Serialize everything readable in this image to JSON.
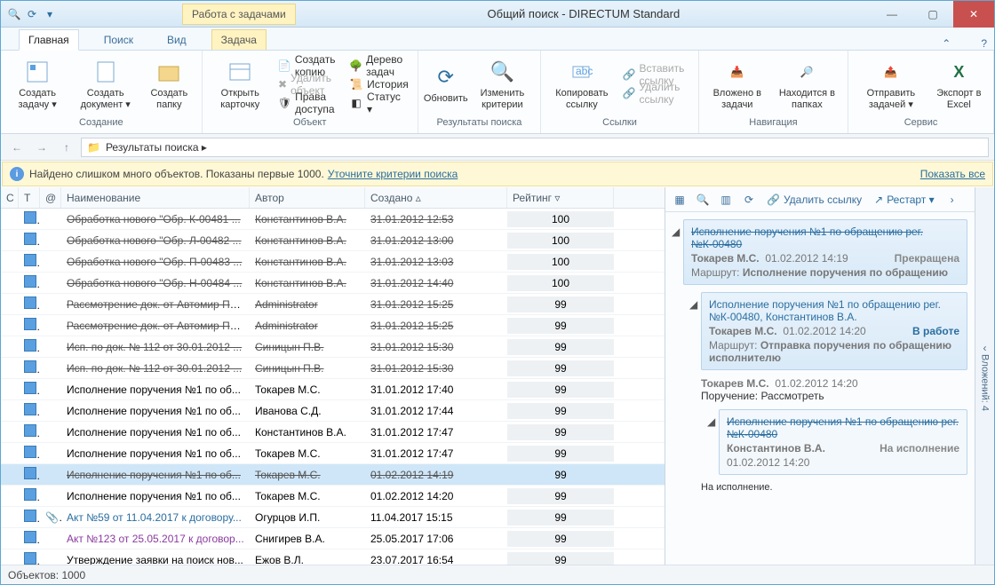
{
  "window": {
    "title": "Общий поиск - DIRECTUM Standard"
  },
  "ctx_header": "Работа с задачами",
  "tabs": {
    "main": "Главная",
    "search": "Поиск",
    "view": "Вид",
    "task": "Задача"
  },
  "ribbon": {
    "create_task": "Создать задачу ▾",
    "create_doc": "Создать документ ▾",
    "create_folder": "Создать папку",
    "open_card": "Открыть карточку",
    "copy": "Создать копию",
    "del": "Удалить объект",
    "rights": "Права доступа",
    "tree": "Дерево задач",
    "history": "История",
    "status": "Статус ▾",
    "refresh": "Обновить",
    "criteria": "Изменить критерии",
    "copylink": "Копировать ссылку",
    "pastelink": "Вставить ссылку",
    "dellink": "Удалить ссылку",
    "inv_tasks": "Вложено в задачи",
    "in_folders": "Находится в папках",
    "send_tasks": "Отправить задачей ▾",
    "excel": "Экспорт в Excel",
    "grp_create": "Создание",
    "grp_obj": "Объект",
    "grp_res": "Результаты поиска",
    "grp_links": "Ссылки",
    "grp_nav": "Навигация",
    "grp_srv": "Сервис"
  },
  "crumb": "Результаты поиска ▸",
  "info": {
    "text": "Найдено слишком много объектов. Показаны первые 1000.",
    "refine": "Уточните критерии поиска",
    "all": "Показать все"
  },
  "cols": {
    "c": "С",
    "t": "Т",
    "a": "@",
    "name": "Наименование",
    "author": "Автор",
    "created": "Создано",
    "rating": "Рейтинг"
  },
  "rows": [
    {
      "strike": true,
      "name": "Обработка нового \"Обр. К-00481 ...",
      "auth": "Константинов В.А.",
      "date": "31.01.2012 12:53",
      "rate": "100"
    },
    {
      "strike": true,
      "name": "Обработка нового \"Обр. Л-00482 ...",
      "auth": "Константинов В.А.",
      "date": "31.01.2012 13:00",
      "rate": "100"
    },
    {
      "strike": true,
      "name": "Обработка нового \"Обр. П-00483 ...",
      "auth": "Константинов В.А.",
      "date": "31.01.2012 13:03",
      "rate": "100"
    },
    {
      "strike": true,
      "name": "Обработка нового \"Обр. Н-00484 ...",
      "auth": "Константинов В.А.",
      "date": "31.01.2012 14:40",
      "rate": "100"
    },
    {
      "strike": true,
      "name": "Рассмотрение док. от Автомир Пи...",
      "auth": "Administrator",
      "date": "31.01.2012 15:25",
      "rate": "99"
    },
    {
      "strike": true,
      "name": "Рассмотрение док. от Автомир Пи...",
      "auth": "Administrator",
      "date": "31.01.2012 15:25",
      "rate": "99"
    },
    {
      "strike": true,
      "name": "Исп. по док. № 112 от 30.01.2012 ...",
      "auth": "Синицын П.В.",
      "date": "31.01.2012 15:30",
      "rate": "99"
    },
    {
      "strike": true,
      "name": "Исп. по док. № 112 от 30.01.2012 ...",
      "auth": "Синицын П.В.",
      "date": "31.01.2012 15:30",
      "rate": "99"
    },
    {
      "strike": false,
      "name": "Исполнение поручения №1 по об...",
      "auth": "Токарев М.С.",
      "date": "31.01.2012 17:40",
      "rate": "99"
    },
    {
      "strike": false,
      "name": "Исполнение поручения №1 по об...",
      "auth": "Иванова С.Д.",
      "date": "31.01.2012 17:44",
      "rate": "99"
    },
    {
      "strike": false,
      "name": "Исполнение поручения №1 по об...",
      "auth": "Константинов В.А.",
      "date": "31.01.2012 17:47",
      "rate": "99"
    },
    {
      "strike": false,
      "name": "Исполнение поручения №1 по об...",
      "auth": "Токарев М.С.",
      "date": "31.01.2012 17:47",
      "rate": "99"
    },
    {
      "strike": true,
      "sel": true,
      "name": "Исполнение поручения №1 по об...",
      "auth": "Токарев М.С.",
      "date": "01.02.2012 14:19",
      "rate": "99"
    },
    {
      "strike": false,
      "name": "Исполнение поручения №1 по об...",
      "auth": "Токарев М.С.",
      "date": "01.02.2012 14:20",
      "rate": "99"
    },
    {
      "strike": false,
      "link": true,
      "att": true,
      "name": "Акт №59 от 11.04.2017 к договору...",
      "auth": "Огурцов И.П.",
      "date": "11.04.2017 15:15",
      "rate": "99"
    },
    {
      "strike": false,
      "link": true,
      "purple": true,
      "name": "Акт №123 от 25.05.2017 к договор...",
      "auth": "Снигирев В.А.",
      "date": "25.05.2017 17:06",
      "rate": "99"
    },
    {
      "strike": false,
      "name": "Утверждение заявки на поиск нов...",
      "auth": "Ежов В.Л.",
      "date": "23.07.2017 16:54",
      "rate": "99"
    }
  ],
  "detail": {
    "toolbar": {
      "del": "Удалить ссылку",
      "restart": "Рестарт ▾"
    },
    "c1": {
      "title": "Исполнение поручения №1 по обращению рег.№К-00480",
      "who": "Токарев М.С.",
      "date": "01.02.2012 14:19",
      "status": "Прекращена",
      "route": "Маршрут:",
      "route_v": "Исполнение поручения по обращению"
    },
    "c2": {
      "title": "Исполнение поручения №1 по обращению рег.№К-00480, Константинов В.А.",
      "who": "Токарев М.С.",
      "date": "01.02.2012 14:20",
      "status": "В работе",
      "route": "Маршрут:",
      "route_v": "Отправка поручения по обращению исполнителю"
    },
    "n1": {
      "who": "Токарев М.С.",
      "date": "01.02.2012 14:20",
      "label": "Поручение:",
      "text": "Рассмотреть"
    },
    "c3": {
      "title": "Исполнение поручения №1 по обращению рег.№К-00480",
      "who": "Константинов В.А.",
      "date": "01.02.2012 14:20",
      "status": "На исполнение"
    },
    "n2": "На исполнение."
  },
  "side": "Вложений: 4",
  "status": "Объектов: 1000"
}
